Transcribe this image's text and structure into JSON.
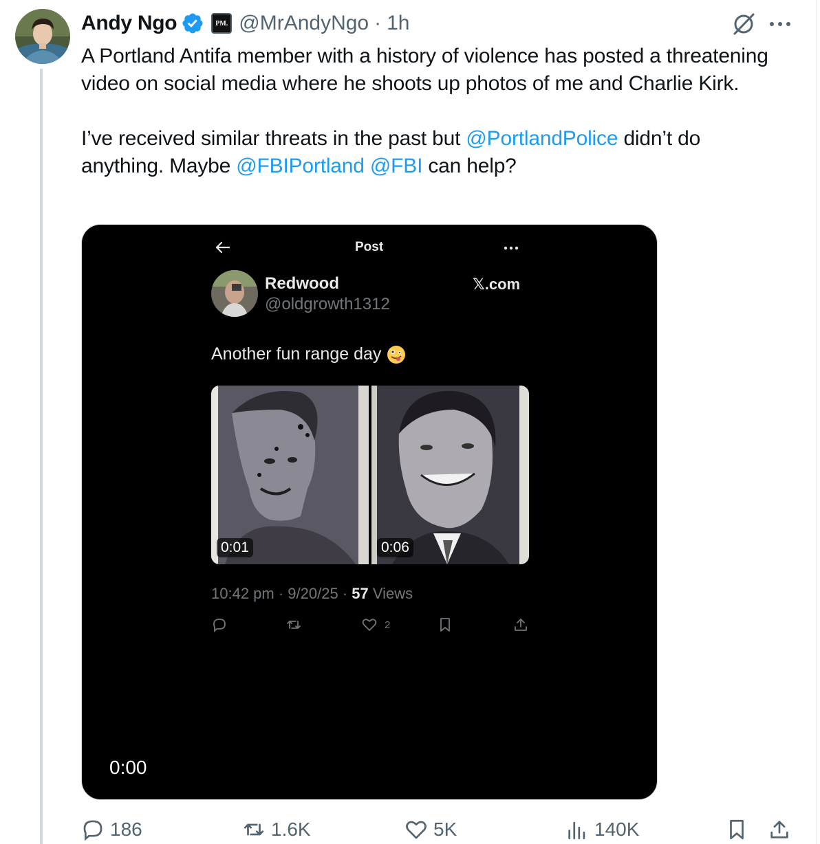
{
  "tweet": {
    "author_name": "Andy Ngo",
    "handle": "@MrAndyNgo",
    "separator": "·",
    "time": "1h",
    "affiliate_badge_text": "PM.",
    "text_line1": "A Portland Antifa member with a history of violence has posted a threatening video on social media where he shoots up photos of me and Charlie Kirk.",
    "text_line2_a": "I’ve received similar threats in the past but ",
    "mention_1": "@PortlandPolice",
    "text_line2_b": " didn’t do anything. Maybe ",
    "mention_2": "@FBIPortland",
    "text_line2_c": " ",
    "mention_3": "@FBI",
    "text_line2_d": " can help?",
    "accent_color": "#1d9bf0"
  },
  "media": {
    "timer": "0:00",
    "inner_post": {
      "header_title": "Post",
      "name": "Redwood",
      "handle": "@oldgrowth1312",
      "source": "𝕏.com",
      "text": "Another fun range day",
      "emoji": "zany-face-icon",
      "videos": [
        {
          "duration": "0:01"
        },
        {
          "duration": "0:06"
        }
      ],
      "meta_time": "10:42 pm · 9/20/25 · ",
      "meta_views_count": "57",
      "meta_views_label": " Views",
      "like_count": "2"
    }
  },
  "actions": {
    "replies": "186",
    "reposts": "1.6K",
    "likes": "5K",
    "views": "140K"
  }
}
